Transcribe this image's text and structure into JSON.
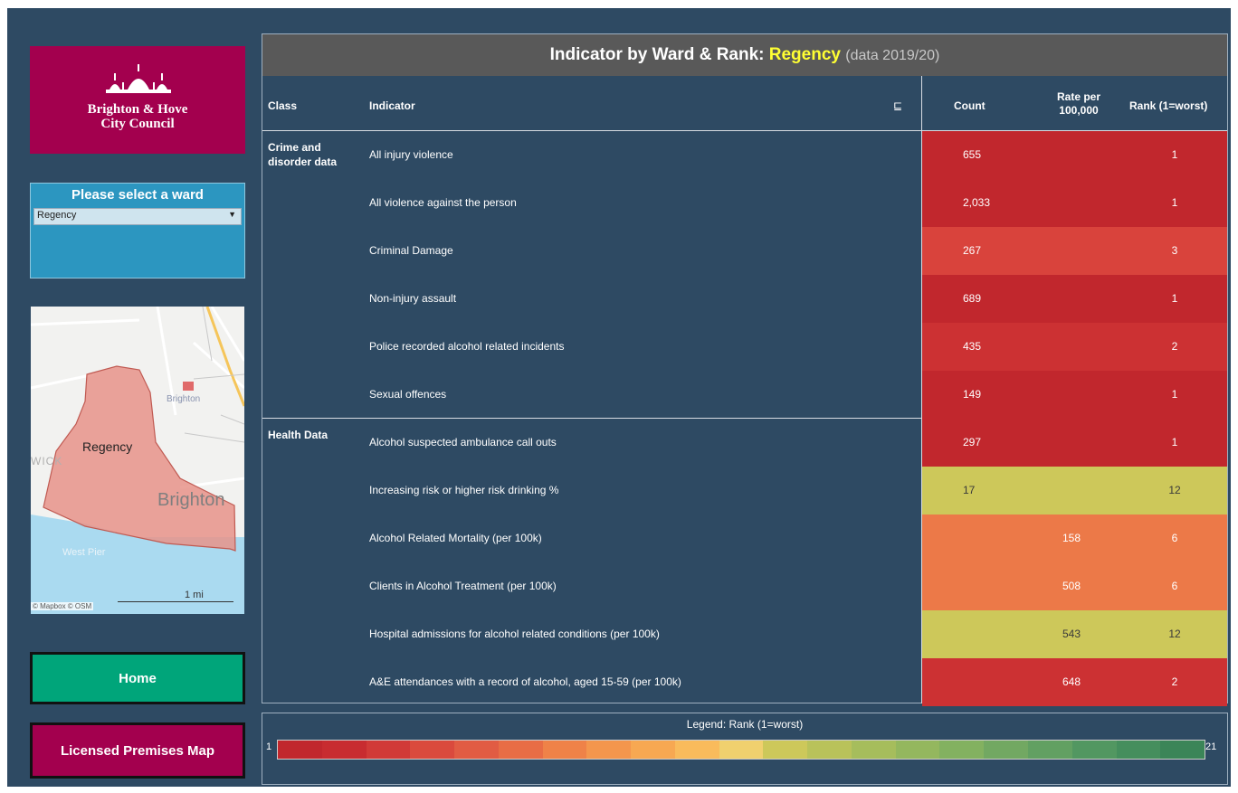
{
  "logo": {
    "line1": "Brighton & Hove",
    "line2": "City Council",
    "color": "#a3004e"
  },
  "ward_selector": {
    "title": "Please select a ward",
    "selected": "Regency"
  },
  "map": {
    "ward_label": "Regency",
    "place_brighton_station": "Brighton",
    "place_brighton": "Brighton",
    "place_west_pier": "West Pier",
    "place_wick": "WICK",
    "scale": "1 mi",
    "attribution": "© Mapbox © OSM"
  },
  "buttons": {
    "home": "Home",
    "licensed_premises_map": "Licensed Premises Map"
  },
  "table": {
    "title_prefix": "Indicator by Ward & Rank:",
    "title_ward": "Regency",
    "title_year": "(data 2019/20)",
    "headers": {
      "class": "Class",
      "indicator": "Indicator",
      "count": "Count",
      "rate": "Rate per 100,000",
      "rank": "Rank (1=worst)"
    },
    "rows": [
      {
        "class": "Crime and disorder data",
        "indicator": "All injury violence",
        "count": "655",
        "rate": "",
        "rank": "1",
        "color": "#c1272d"
      },
      {
        "class": "",
        "indicator": "All violence against the person",
        "count": "2,033",
        "rate": "",
        "rank": "1",
        "color": "#c1272d"
      },
      {
        "class": "",
        "indicator": "Criminal Damage",
        "count": "267",
        "rate": "",
        "rank": "3",
        "color": "#d9433c"
      },
      {
        "class": "",
        "indicator": "Non-injury assault",
        "count": "689",
        "rate": "",
        "rank": "1",
        "color": "#c1272d"
      },
      {
        "class": "",
        "indicator": "Police recorded alcohol related incidents",
        "count": "435",
        "rate": "",
        "rank": "2",
        "color": "#cc3133"
      },
      {
        "class": "",
        "indicator": "Sexual offences",
        "count": "149",
        "rate": "",
        "rank": "1",
        "color": "#c1272d"
      },
      {
        "class": "Health Data",
        "indicator": "Alcohol suspected ambulance call outs",
        "count": "297",
        "rate": "",
        "rank": "1",
        "color": "#c1272d"
      },
      {
        "class": "",
        "indicator": "Increasing risk or higher risk drinking %",
        "count": "17",
        "rate": "",
        "rank": "12",
        "color": "#cdc85a"
      },
      {
        "class": "",
        "indicator": "Alcohol Related Mortality (per 100k)",
        "count": "",
        "rate": "158",
        "rank": "6",
        "color": "#ec7948"
      },
      {
        "class": "",
        "indicator": "Clients in Alcohol Treatment (per 100k)",
        "count": "",
        "rate": "508",
        "rank": "6",
        "color": "#ec7948"
      },
      {
        "class": "",
        "indicator": "Hospital admissions for alcohol related conditions (per 100k)",
        "count": "",
        "rate": "543",
        "rank": "12",
        "color": "#cdc85a"
      },
      {
        "class": "",
        "indicator": "A&E attendances with a record of alcohol, aged 15-59 (per 100k)",
        "count": "",
        "rate": "648",
        "rank": "2",
        "color": "#cc3133"
      }
    ]
  },
  "legend": {
    "title": "Legend: Rank (1=worst)",
    "min": "1",
    "max": "21",
    "colors": [
      "#c1272d",
      "#c82c30",
      "#d13a37",
      "#da4a3d",
      "#e15c43",
      "#e86d45",
      "#ef8248",
      "#f4964d",
      "#f7a852",
      "#f9bb5c",
      "#f0d06e",
      "#cdc85a",
      "#b9c25a",
      "#a6bd5c",
      "#94b75e",
      "#83b160",
      "#72a862",
      "#62a062",
      "#529761",
      "#458e5d",
      "#3b8558"
    ]
  }
}
